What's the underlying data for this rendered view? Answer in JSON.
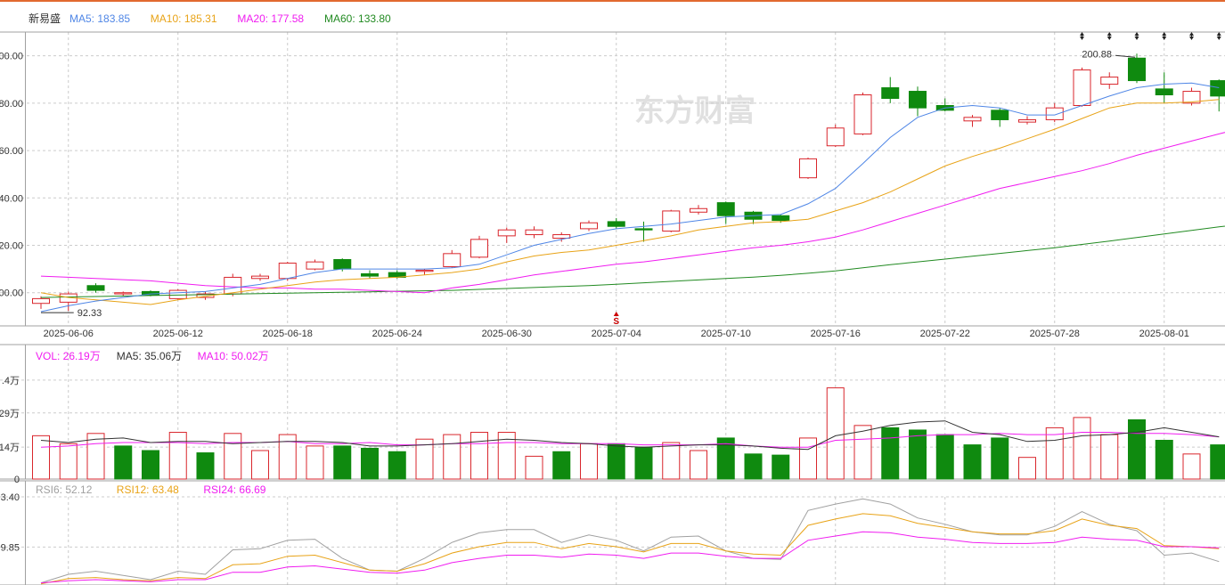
{
  "stock_name": "新易盛",
  "watermark": "东方财富",
  "colors": {
    "up": "#d9262c",
    "down": "#0f8a0f",
    "ma5": "#4f86e6",
    "ma10": "#e8a317",
    "ma20": "#f01cf0",
    "ma60": "#218a21",
    "vol_ma5": "#333333",
    "rsi6": "#a0a0a0",
    "rsi12": "#e8a317",
    "rsi24": "#f01cf0",
    "grid": "#cccccc",
    "panel_border": "#a0a0a0"
  },
  "legends": {
    "price": [
      {
        "key": "ma5",
        "text": "MA5: 183.85"
      },
      {
        "key": "ma10",
        "text": "MA10: 185.31"
      },
      {
        "key": "ma20",
        "text": "MA20: 177.58"
      },
      {
        "key": "ma60",
        "text": "MA60: 133.80"
      }
    ],
    "volume": [
      {
        "key": "ma20",
        "text": "VOL: 26.19万"
      },
      {
        "key": "vol_ma5",
        "text": "MA5: 35.06万"
      },
      {
        "key": "ma20",
        "text": "MA10: 50.02万"
      }
    ],
    "rsi": [
      {
        "key": "rsi6",
        "text": "RSI6: 52.12"
      },
      {
        "key": "rsi12",
        "text": "RSI12: 63.48"
      },
      {
        "key": "rsi24",
        "text": "RSI24: 66.69"
      }
    ]
  },
  "annotations": {
    "low_label": "92.33",
    "high_label": "200.88",
    "event_marker": "S"
  },
  "chart_data": [
    {
      "type": "candlestick",
      "title": "",
      "dates": [
        "2025-06-05",
        "2025-06-06",
        "2025-06-09",
        "2025-06-10",
        "2025-06-11",
        "2025-06-12",
        "2025-06-13",
        "2025-06-16",
        "2025-06-17",
        "2025-06-18",
        "2025-06-19",
        "2025-06-20",
        "2025-06-23",
        "2025-06-24",
        "2025-06-25",
        "2025-06-26",
        "2025-06-27",
        "2025-06-30",
        "2025-07-01",
        "2025-07-02",
        "2025-07-03",
        "2025-07-04",
        "2025-07-07",
        "2025-07-08",
        "2025-07-09",
        "2025-07-10",
        "2025-07-11",
        "2025-07-14",
        "2025-07-15",
        "2025-07-16",
        "2025-07-17",
        "2025-07-18",
        "2025-07-21",
        "2025-07-22",
        "2025-07-23",
        "2025-07-24",
        "2025-07-25",
        "2025-07-28",
        "2025-07-29",
        "2025-07-30",
        "2025-07-31",
        "2025-08-01",
        "2025-08-04",
        "2025-08-05"
      ],
      "x_tick_labels": [
        "2025-06-06",
        "2025-06-12",
        "2025-06-18",
        "2025-06-24",
        "2025-06-30",
        "2025-07-04",
        "2025-07-10",
        "2025-07-16",
        "2025-07-22",
        "2025-07-28",
        "2025-08-01"
      ],
      "x_tick_index": [
        1,
        5,
        9,
        13,
        17,
        21,
        25,
        29,
        33,
        37,
        41
      ],
      "y_ticks": [
        100,
        120,
        140,
        160,
        180,
        200
      ],
      "y_tick_labels": [
        "00.00",
        "20.00",
        "40.00",
        "60.00",
        "80.00",
        "00.00"
      ],
      "ylim": [
        86,
        210
      ],
      "ohlc": [
        [
          95.5,
          98.5,
          93.2,
          97.5
        ],
        [
          96.0,
          100.5,
          92.33,
          99.5
        ],
        [
          103.0,
          104.0,
          100.0,
          101.0
        ],
        [
          99.5,
          100.5,
          98.5,
          100.0
        ],
        [
          100.5,
          101.0,
          98.5,
          99.0
        ],
        [
          97.5,
          101.5,
          97.0,
          101.0
        ],
        [
          98.0,
          100.5,
          97.0,
          99.5
        ],
        [
          99.5,
          108.0,
          98.5,
          106.5
        ],
        [
          106.0,
          108.0,
          105.0,
          107.0
        ],
        [
          106.0,
          113.0,
          105.0,
          112.5
        ],
        [
          110.0,
          114.0,
          109.5,
          113.0
        ],
        [
          114.0,
          114.5,
          109.0,
          110.0
        ],
        [
          108.0,
          109.5,
          106.0,
          107.0
        ],
        [
          108.5,
          109.5,
          106.0,
          106.5
        ],
        [
          109.0,
          110.0,
          107.5,
          109.5
        ],
        [
          111.0,
          118.0,
          110.5,
          116.5
        ],
        [
          115.0,
          124.0,
          114.5,
          122.5
        ],
        [
          124.0,
          127.5,
          121.0,
          126.5
        ],
        [
          124.5,
          128.0,
          123.0,
          126.5
        ],
        [
          123.0,
          125.5,
          121.5,
          124.5
        ],
        [
          127.0,
          130.5,
          126.0,
          129.5
        ],
        [
          130.0,
          131.5,
          127.0,
          128.0
        ],
        [
          127.0,
          130.0,
          121.5,
          126.5
        ],
        [
          126.0,
          135.0,
          125.5,
          134.5
        ],
        [
          134.0,
          137.0,
          133.0,
          135.5
        ],
        [
          138.0,
          138.5,
          129.0,
          132.5
        ],
        [
          134.0,
          134.5,
          129.0,
          131.0
        ],
        [
          132.5,
          133.0,
          129.5,
          130.5
        ],
        [
          148.5,
          157.0,
          148.0,
          156.5
        ],
        [
          162.0,
          171.0,
          161.5,
          169.5
        ],
        [
          167.0,
          184.5,
          166.5,
          183.5
        ],
        [
          186.5,
          191.0,
          180.0,
          182.0
        ],
        [
          185.0,
          187.0,
          174.5,
          178.0
        ],
        [
          179.0,
          182.0,
          176.5,
          177.0
        ],
        [
          172.5,
          175.0,
          170.0,
          174.0
        ],
        [
          177.0,
          178.0,
          170.0,
          173.0
        ],
        [
          172.0,
          174.5,
          171.0,
          173.0
        ],
        [
          173.0,
          180.0,
          172.0,
          178.0
        ],
        [
          179.0,
          195.0,
          178.5,
          194.0
        ],
        [
          188.0,
          193.0,
          186.0,
          191.0
        ],
        [
          199.0,
          200.88,
          188.5,
          189.5
        ],
        [
          186.0,
          193.0,
          180.0,
          183.5
        ],
        [
          180.0,
          186.5,
          179.0,
          185.0
        ],
        [
          189.5,
          190.0,
          176.5,
          183.0
        ]
      ],
      "ma5": [
        92.0,
        94.5,
        96.5,
        98.0,
        99.5,
        100.0,
        100.5,
        102.0,
        103.5,
        106.0,
        108.5,
        110.0,
        110.0,
        110.0,
        110.0,
        110.5,
        112.0,
        116.0,
        120.0,
        122.5,
        125.0,
        127.0,
        128.0,
        129.0,
        130.5,
        132.0,
        132.5,
        133.0,
        137.5,
        144.0,
        154.5,
        165.5,
        174.0,
        178.0,
        179.0,
        178.0,
        175.0,
        175.0,
        179.0,
        183.0,
        186.5,
        188.0,
        188.5,
        186.5
      ],
      "ma10": [
        100.0,
        98.0,
        97.0,
        96.0,
        95.0,
        97.0,
        98.5,
        100.0,
        101.5,
        103.0,
        104.5,
        105.5,
        106.0,
        106.5,
        107.5,
        108.5,
        110.0,
        113.0,
        115.5,
        117.0,
        118.0,
        120.0,
        122.0,
        124.0,
        126.5,
        128.0,
        129.5,
        130.0,
        131.0,
        134.5,
        138.0,
        142.5,
        148.0,
        153.5,
        157.5,
        161.0,
        165.0,
        169.0,
        173.5,
        178.0,
        180.0,
        180.0,
        180.5,
        181.5
      ],
      "ma20": [
        107.0,
        106.5,
        106.0,
        105.5,
        105.0,
        104.0,
        103.0,
        102.5,
        102.0,
        102.0,
        101.5,
        101.5,
        101.0,
        100.5,
        100.0,
        102.0,
        103.5,
        105.5,
        107.5,
        109.0,
        110.5,
        112.0,
        113.0,
        114.5,
        116.0,
        117.5,
        119.0,
        120.0,
        121.5,
        123.5,
        126.5,
        130.0,
        133.5,
        137.0,
        140.5,
        144.0,
        146.5,
        149.0,
        151.5,
        154.5,
        158.0,
        161.0,
        164.0,
        167.0,
        170.0
      ],
      "ma60": [
        98.0,
        98.2,
        98.4,
        98.6,
        98.8,
        99.0,
        99.2,
        99.4,
        99.6,
        99.8,
        100.0,
        100.2,
        100.4,
        100.6,
        100.8,
        101.0,
        101.4,
        101.8,
        102.2,
        102.6,
        103.0,
        103.6,
        104.2,
        104.8,
        105.4,
        106.0,
        106.6,
        107.3,
        108.2,
        109.2,
        110.5,
        111.8,
        113.0,
        114.2,
        115.4,
        116.6,
        117.8,
        119.0,
        120.4,
        121.8,
        123.3,
        124.8,
        126.3,
        127.8,
        129.2,
        130.5
      ],
      "annotations": [
        "92.33",
        "200.88",
        "S"
      ]
    },
    {
      "type": "bar",
      "title": "",
      "series_name": "VOL",
      "y_tick_labels": [
        ".4万",
        "29万",
        "14万",
        "0"
      ],
      "y_ticks": [
        43.4,
        29.0,
        14.0,
        0
      ],
      "ylim": [
        0,
        50
      ],
      "values": [
        19.0,
        15.5,
        20.0,
        14.5,
        12.5,
        20.5,
        11.5,
        20.0,
        12.5,
        19.5,
        14.5,
        14.5,
        13.5,
        12.0,
        17.5,
        19.5,
        20.5,
        20.5,
        10.0,
        12.0,
        15.5,
        15.5,
        14.0,
        16.0,
        12.5,
        18.0,
        11.0,
        10.5,
        18.0,
        40.0,
        23.5,
        22.5,
        21.5,
        19.5,
        15.0,
        18.0,
        9.5,
        22.5,
        27.0,
        19.5,
        26.0,
        17.0,
        11.0,
        15.0
      ],
      "down": [
        false,
        false,
        false,
        true,
        true,
        false,
        true,
        false,
        false,
        false,
        false,
        true,
        true,
        true,
        false,
        false,
        false,
        false,
        false,
        true,
        false,
        true,
        true,
        false,
        false,
        true,
        true,
        true,
        false,
        false,
        false,
        true,
        true,
        true,
        true,
        true,
        false,
        false,
        false,
        false,
        true,
        true,
        false,
        true
      ],
      "ma5": [
        17.0,
        16.0,
        17.5,
        18.0,
        16.0,
        16.5,
        16.5,
        15.5,
        16.0,
        16.5,
        16.5,
        16.0,
        14.5,
        14.5,
        15.0,
        15.5,
        16.5,
        17.5,
        17.0,
        16.0,
        15.5,
        14.5,
        14.0,
        14.5,
        15.0,
        15.0,
        14.5,
        13.5,
        13.0,
        19.0,
        21.0,
        23.5,
        25.0,
        25.5,
        20.5,
        19.5,
        16.5,
        17.0,
        19.0,
        19.5,
        20.5,
        22.5,
        20.5,
        18.5
      ],
      "ma10": [
        14.0,
        14.5,
        15.5,
        16.0,
        16.0,
        16.0,
        15.5,
        16.0,
        16.0,
        16.5,
        15.5,
        15.5,
        16.0,
        15.0,
        15.0,
        15.5,
        15.5,
        16.0,
        16.0,
        15.5,
        15.5,
        15.5,
        15.0,
        15.0,
        15.0,
        15.5,
        14.5,
        14.0,
        14.0,
        17.0,
        17.5,
        18.0,
        19.0,
        19.5,
        19.5,
        20.0,
        19.5,
        19.5,
        20.5,
        20.5,
        20.0,
        20.0,
        19.5,
        18.5
      ]
    },
    {
      "type": "line",
      "title": "",
      "y_tick_labels": [
        "3.40",
        "9.85"
      ],
      "y_ticks": [
        63.4,
        39.85
      ],
      "ylim": [
        22,
        63.4
      ],
      "rsi6": [
        23.0,
        27.0,
        28.5,
        26.5,
        24.5,
        28.5,
        27.0,
        38.5,
        39.0,
        43.0,
        43.5,
        34.5,
        29.0,
        28.5,
        34.5,
        42.0,
        46.5,
        48.0,
        48.0,
        42.0,
        45.5,
        43.0,
        38.0,
        44.5,
        45.0,
        38.0,
        34.5,
        34.0,
        57.0,
        60.0,
        62.5,
        60.0,
        53.5,
        50.5,
        47.0,
        45.5,
        45.5,
        49.5,
        56.5,
        50.5,
        47.5,
        36.0,
        37.0,
        33.0
      ],
      "rsi12": [
        22.5,
        25.0,
        25.5,
        24.5,
        24.0,
        25.5,
        25.0,
        31.5,
        32.0,
        35.5,
        36.0,
        32.5,
        29.0,
        28.5,
        32.0,
        37.0,
        40.0,
        42.0,
        42.0,
        39.0,
        41.5,
        40.0,
        37.5,
        41.5,
        41.5,
        38.0,
        36.5,
        36.0,
        50.0,
        53.0,
        55.5,
        54.5,
        51.0,
        49.0,
        47.0,
        46.0,
        46.0,
        47.5,
        53.0,
        50.0,
        48.5,
        40.5,
        40.0,
        39.0
      ],
      "rsi24": [
        23.0,
        24.0,
        24.5,
        24.0,
        23.5,
        24.5,
        24.5,
        28.0,
        28.0,
        30.5,
        31.0,
        29.5,
        28.0,
        27.5,
        29.0,
        32.5,
        34.5,
        36.0,
        36.0,
        35.0,
        36.5,
        36.0,
        34.5,
        37.0,
        37.0,
        35.5,
        34.5,
        34.5,
        43.0,
        45.0,
        47.0,
        46.5,
        44.5,
        43.5,
        42.0,
        41.5,
        41.5,
        42.0,
        44.5,
        43.5,
        43.0,
        40.0,
        40.0,
        39.5
      ]
    }
  ]
}
